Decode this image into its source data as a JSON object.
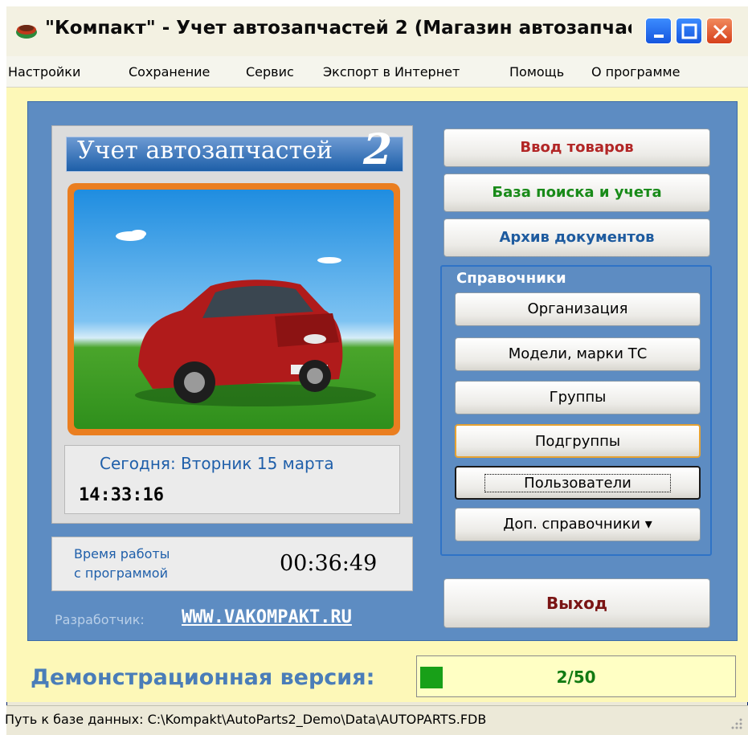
{
  "window": {
    "title": "\"Компакт\" - Учет автозапчастей 2 (Магазин автозапчас...",
    "controls": [
      "minimize",
      "maximize",
      "close"
    ]
  },
  "menu": {
    "items": [
      "Настройки",
      "Сохранение",
      "Сервис",
      "Экспорт в Интернет",
      "Помощь",
      "О программе"
    ]
  },
  "logo": {
    "text": "Учет автозапчастей",
    "number": "2"
  },
  "today": {
    "date": "Сегодня: Вторник 15 марта",
    "time": "14:33:16"
  },
  "work_time": {
    "label_line1": "Время работы",
    "label_line2": "с программой",
    "value": "00:36:49"
  },
  "developer": {
    "label": "Разработчик:",
    "link": "WWW.VAKOMPAKT.RU"
  },
  "buttons": {
    "input_goods": "Ввод товаров",
    "search_base": "База поиска и учета",
    "archive": "Архив документов",
    "exit": "Выход"
  },
  "references": {
    "title": "Справочники",
    "items": [
      "Организация",
      "Модели, марки ТС",
      "Группы",
      "Подгруппы",
      "Пользователи",
      "Доп. справочники ▾"
    ]
  },
  "demo": {
    "label": "Демонстрационная версия:",
    "count": "2/50",
    "progress_fraction": 0.04
  },
  "status": {
    "path": "Путь к базе данных: C:\\Kompakt\\AutoParts2_Demo\\Data\\AUTOPARTS.FDB"
  },
  "colors": {
    "panel_blue": "#5d8cc2",
    "background_yellow": "#fdf8b8",
    "accent_red": "#b22626",
    "accent_green": "#188a18"
  }
}
